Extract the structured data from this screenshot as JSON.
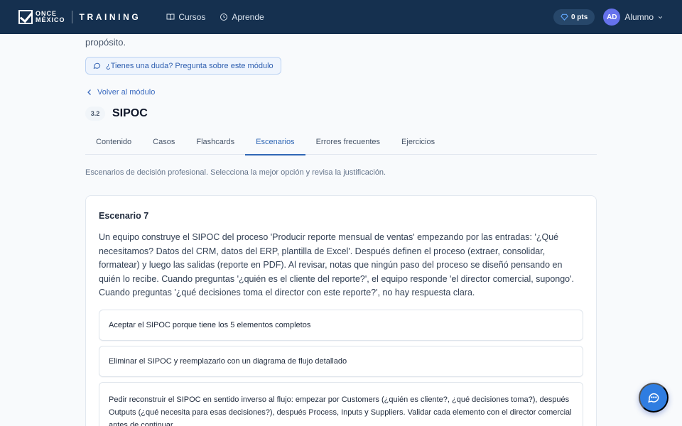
{
  "brand": {
    "logo_line1": "ONCE",
    "logo_line2": "MÉXICO",
    "product": "TRAINING"
  },
  "nav": {
    "items": [
      {
        "label": "Cursos",
        "icon": "book-icon"
      },
      {
        "label": "Aprende",
        "icon": "compass-icon"
      }
    ]
  },
  "user": {
    "points": "0 pts",
    "initials": "AD",
    "name": "Alumno"
  },
  "page": {
    "previous_text_tail": "propósito.",
    "ask_button": "¿Tienes una duda? Pregunta sobre este módulo",
    "back_link": "Volver al módulo",
    "module_number": "3.2",
    "module_title": "SIPOC",
    "tabs": [
      "Contenido",
      "Casos",
      "Flashcards",
      "Escenarios",
      "Errores frecuentes",
      "Ejercicios"
    ],
    "active_tab": "Escenarios",
    "intro": "Escenarios de decisión profesional. Selecciona la mejor opción y revisa la justificación."
  },
  "scenario": {
    "title": "Escenario 7",
    "text": "Un equipo construye el SIPOC del proceso 'Producir reporte mensual de ventas' empezando por las entradas: '¿Qué necesitamos? Datos del CRM, datos del ERP, plantilla de Excel'. Después definen el proceso (extraer, consolidar, formatear) y luego las salidas (reporte en PDF). Al revisar, notas que ningún paso del proceso se diseñó pensando en quién lo recibe. Cuando preguntas '¿quién es el cliente del reporte?', el equipo responde 'el director comercial, supongo'. Cuando preguntas '¿qué decisiones toma el director con este reporte?', no hay respuesta clara.",
    "options": [
      "Aceptar el SIPOC porque tiene los 5 elementos completos",
      "Eliminar el SIPOC y reemplazarlo con un diagrama de flujo detallado",
      "Pedir reconstruir el SIPOC en sentido inverso al flujo: empezar por Customers (¿quién es cliente?, ¿qué decisiones toma?), después Outputs (¿qué necesita para esas decisiones?), después Process, Inputs y Suppliers. Validar cada elemento con el director comercial antes de continuar."
    ]
  },
  "colors": {
    "topbar": "#15304f",
    "accent": "#2f67b5",
    "avatar": "#6672ec",
    "fab": "#2f7de1"
  }
}
